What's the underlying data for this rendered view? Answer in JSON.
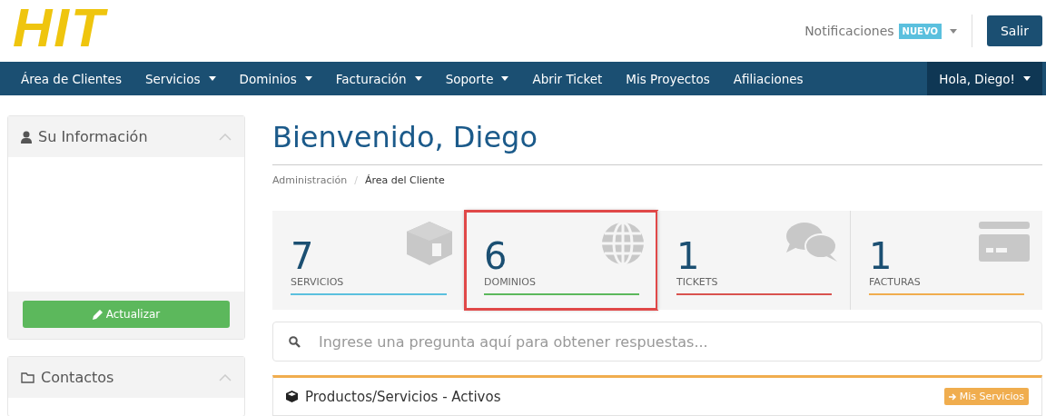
{
  "logo": {
    "text": "HIT"
  },
  "header": {
    "notifications": {
      "label": "Notificaciones",
      "badge": "NUEVO"
    },
    "logout": "Salir"
  },
  "nav": {
    "items": [
      {
        "label": "Área de Clientes",
        "dropdown": false,
        "selected": false
      },
      {
        "label": "Servicios",
        "dropdown": true,
        "selected": false
      },
      {
        "label": "Dominios",
        "dropdown": true,
        "selected": false
      },
      {
        "label": "Facturación",
        "dropdown": true,
        "selected": false
      },
      {
        "label": "Soporte",
        "dropdown": true,
        "selected": false
      },
      {
        "label": "Abrir Ticket",
        "dropdown": false,
        "selected": false
      },
      {
        "label": "Mis Proyectos",
        "dropdown": false,
        "selected": false
      },
      {
        "label": "Afiliaciones",
        "dropdown": false,
        "selected": false
      }
    ],
    "user": {
      "label": "Hola, Diego!",
      "selected": true
    }
  },
  "sidebar": {
    "panels": [
      {
        "kind": "info",
        "title": "Su Información",
        "button": "Actualizar"
      },
      {
        "kind": "contacts",
        "title": "Contactos"
      }
    ]
  },
  "main": {
    "title": "Bienvenido, Diego",
    "breadcrumb": [
      "Administración",
      "Área del Cliente"
    ],
    "breadcrumb_separator": "/",
    "tiles": [
      {
        "kind": "box",
        "count": "7",
        "label": "SERVICIOS",
        "color": "#5bc0de",
        "highlighted": false
      },
      {
        "kind": "globe",
        "count": "6",
        "label": "DOMINIOS",
        "color": "#5cb85c",
        "highlighted": true
      },
      {
        "kind": "chat",
        "count": "1",
        "label": "TICKETS",
        "color": "#d9534f",
        "highlighted": false
      },
      {
        "kind": "card",
        "count": "1",
        "label": "FACTURAS",
        "color": "#f0ad4e",
        "highlighted": false
      }
    ],
    "search": {
      "placeholder": "Ingrese una pregunta aquí para obtener respuestas..."
    },
    "products_panel": {
      "title": "Productos/Servicios - Activos",
      "button": "Mis Servicios"
    }
  }
}
